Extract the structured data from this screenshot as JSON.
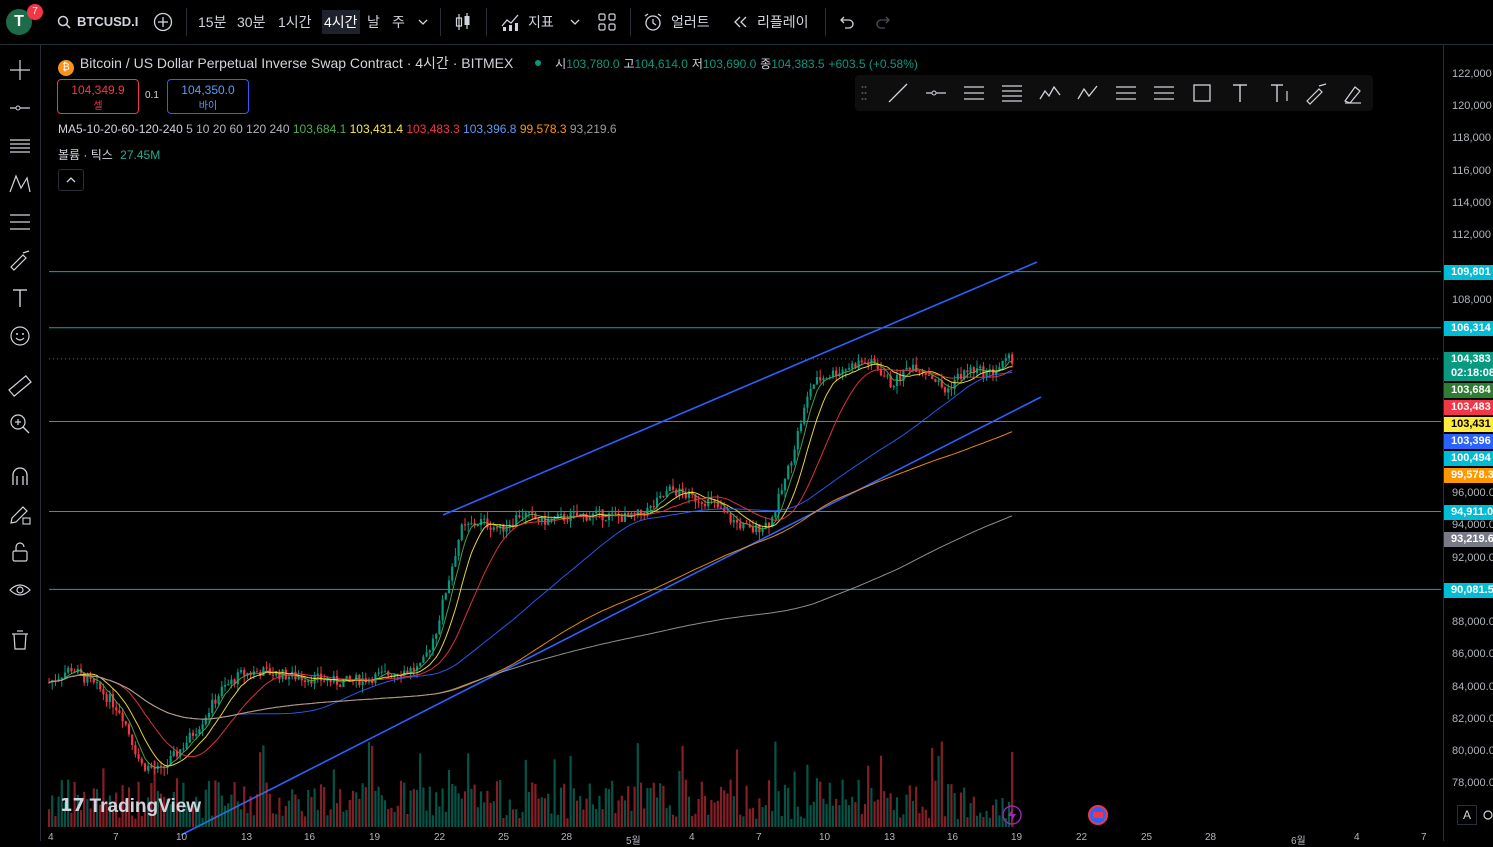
{
  "topbar": {
    "avatar_letter": "T",
    "notification_count": "7",
    "symbol": "BTCUSD.I",
    "intervals": [
      "15분",
      "30분",
      "1시간",
      "4시간",
      "날",
      "주"
    ],
    "active_interval": "4시간",
    "indicators_label": "지표",
    "alert_label": "얼러트",
    "replay_label": "리플레이"
  },
  "legend": {
    "title": "Bitcoin / US Dollar Perpetual Inverse Swap Contract · 4시간 · BITMEX",
    "open_label": "시",
    "open": "103,780.0",
    "high_label": "고",
    "high": "104,614.0",
    "low_label": "저",
    "low": "103,690.0",
    "close_label": "종",
    "close": "104,383.5",
    "change": "+603.5 (+0.58%)",
    "sell_price": "104,349.9",
    "sell_label": "셀",
    "spread": "0.1",
    "buy_price": "104,350.0",
    "buy_label": "바이",
    "ma_name": "MA5-10-20-60-120-240",
    "ma_params": "5 10 20 60 120 240",
    "ma_values": [
      "103,684.1",
      "103,431.4",
      "103,483.3",
      "103,396.8",
      "99,578.3",
      "93,219.6"
    ],
    "ma_colors": [
      "#4caf50",
      "#ffeb3b",
      "#f23645",
      "#2962ff",
      "#ff9800",
      "#9e9e9e"
    ],
    "volume_label": "볼륨 · 틱스",
    "volume_value": "27.45M"
  },
  "price_axis": {
    "labels": [
      "122,000",
      "120,000",
      "118,000",
      "116,000",
      "114,000",
      "112,000",
      "108,000",
      "96,000.0",
      "94,000.0",
      "92,000.0",
      "88,000.0",
      "86,000.0",
      "84,000.0",
      "82,000.0",
      "80,000.0",
      "78,000.0"
    ],
    "tags": [
      {
        "text": "109,801",
        "color": "#00bcd4"
      },
      {
        "text": "106,314",
        "color": "#00bcd4"
      },
      {
        "text": "104,383",
        "color": "#089981"
      },
      {
        "text": "02:18:08",
        "color": "#089981"
      },
      {
        "text": "103,684",
        "color": "#2e7d32"
      },
      {
        "text": "103,483",
        "color": "#f23645"
      },
      {
        "text": "103,431",
        "color": "#ffeb3b"
      },
      {
        "text": "103,396",
        "color": "#2962ff"
      },
      {
        "text": "100,494",
        "color": "#00bcd4"
      },
      {
        "text": "99,578.3",
        "color": "#ff9800"
      },
      {
        "text": "94,911.0",
        "color": "#00bcd4"
      },
      {
        "text": "93,219.6",
        "color": "#787b86"
      },
      {
        "text": "90,081.5",
        "color": "#00bcd4"
      }
    ],
    "auto_label": "A"
  },
  "time_axis": [
    "4",
    "7",
    "10",
    "13",
    "16",
    "19",
    "22",
    "25",
    "28",
    "5월",
    "4",
    "7",
    "10",
    "13",
    "16",
    "19",
    "22",
    "25",
    "28",
    "6월",
    "4",
    "7"
  ],
  "watermark": "TradingView",
  "chart_data": {
    "type": "candlestick",
    "y_range": [
      77000,
      123000
    ],
    "horizontal_levels": [
      109801,
      106314,
      100494,
      94911,
      90081
    ],
    "last_price": 104383.5
  }
}
